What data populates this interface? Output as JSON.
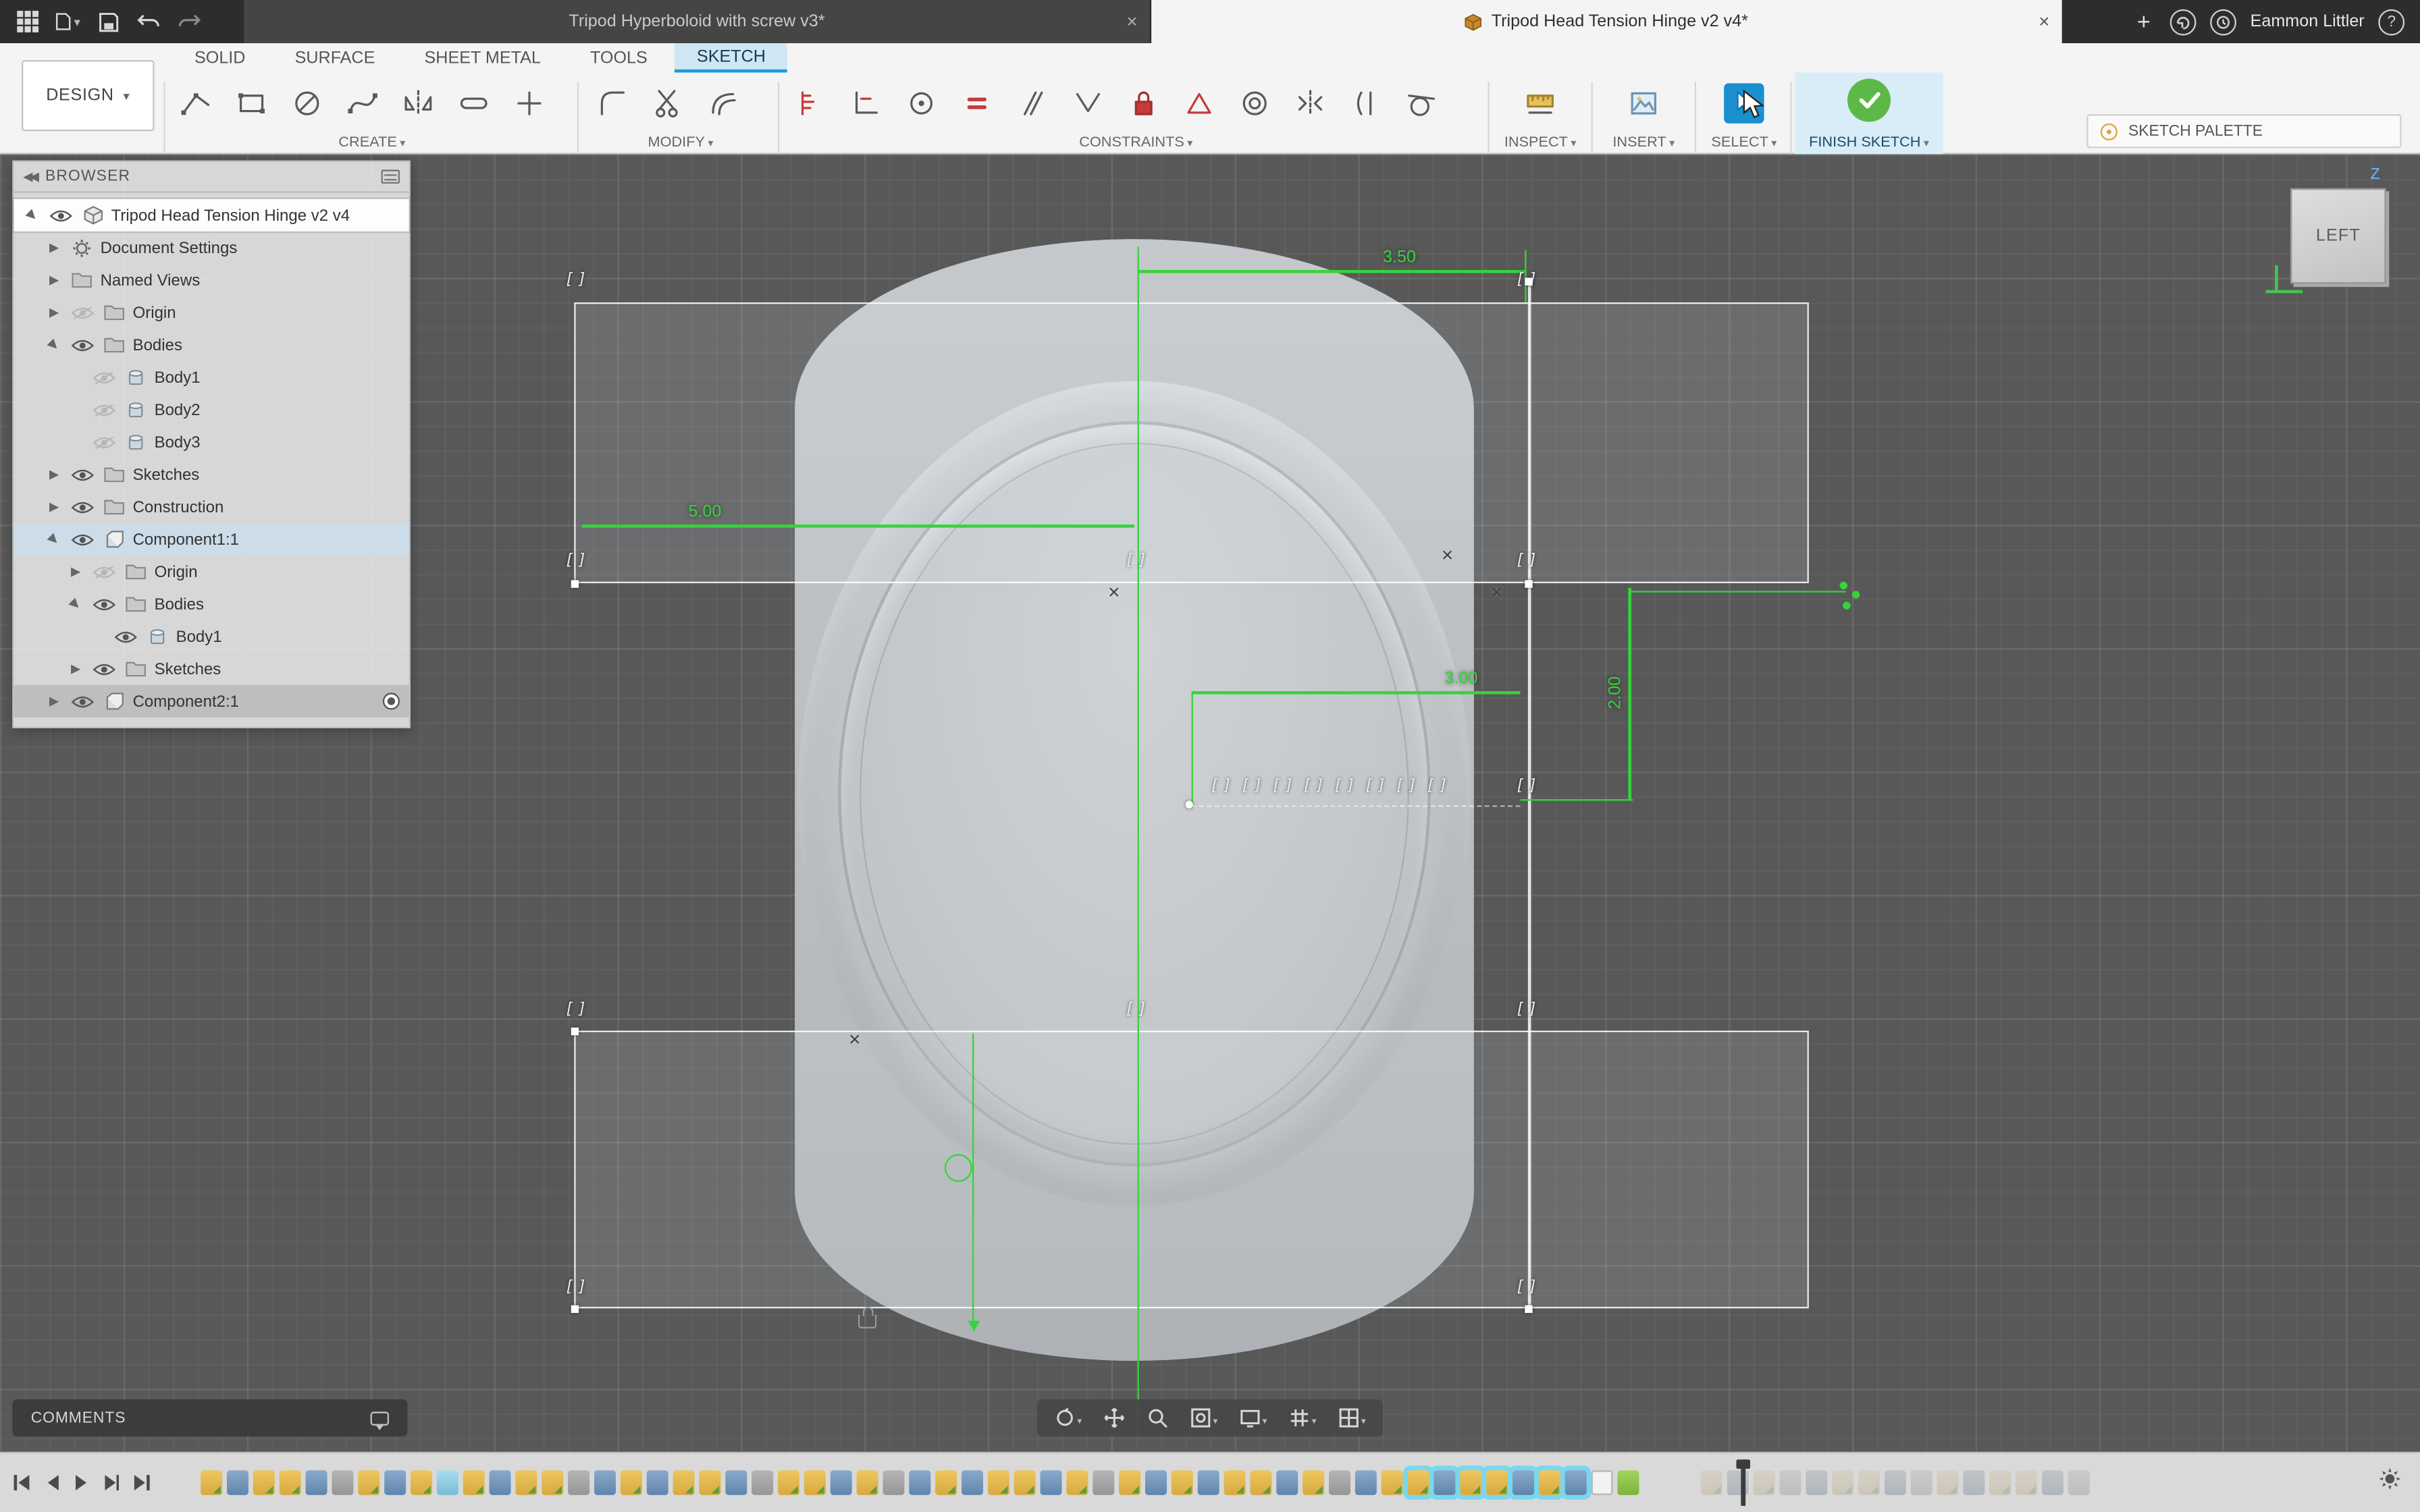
{
  "titlebar": {
    "tabs": [
      {
        "label": "Tripod Hyperboloid with screw v3*",
        "active": false
      },
      {
        "label": "Tripod Head Tension Hinge v2 v4*",
        "active": true
      }
    ],
    "user": "Eammon Littler"
  },
  "ribbon": {
    "design_label": "DESIGN",
    "menu_tabs": [
      {
        "label": "SOLID",
        "active": false
      },
      {
        "label": "SURFACE",
        "active": false
      },
      {
        "label": "SHEET METAL",
        "active": false
      },
      {
        "label": "TOOLS",
        "active": false
      },
      {
        "label": "SKETCH",
        "active": true
      }
    ],
    "groups": [
      {
        "label": "CREATE"
      },
      {
        "label": "MODIFY"
      },
      {
        "label": "CONSTRAINTS"
      },
      {
        "label": "INSPECT"
      },
      {
        "label": "INSERT"
      },
      {
        "label": "SELECT"
      },
      {
        "label": "FINISH SKETCH"
      }
    ],
    "sketch_palette_label": "SKETCH PALETTE"
  },
  "browser": {
    "title": "BROWSER",
    "items": [
      {
        "depth": 0,
        "arrow": "expanded",
        "eye": "on",
        "icon": "document",
        "label": "Tripod Head Tension Hinge v2 v4",
        "highlight": "sel"
      },
      {
        "depth": 1,
        "arrow": "collapsed",
        "eye": null,
        "icon": "gear",
        "label": "Document Settings"
      },
      {
        "depth": 1,
        "arrow": "collapsed",
        "eye": null,
        "icon": "folder",
        "label": "Named Views"
      },
      {
        "depth": 1,
        "arrow": "collapsed",
        "eye": "off",
        "icon": "folder",
        "label": "Origin"
      },
      {
        "depth": 1,
        "arrow": "expanded",
        "eye": "on",
        "icon": "folder",
        "label": "Bodies"
      },
      {
        "depth": 2,
        "arrow": null,
        "eye": "off",
        "icon": "body",
        "label": "Body1"
      },
      {
        "depth": 2,
        "arrow": null,
        "eye": "off",
        "icon": "body",
        "label": "Body2"
      },
      {
        "depth": 2,
        "arrow": null,
        "eye": "off",
        "icon": "body",
        "label": "Body3"
      },
      {
        "depth": 1,
        "arrow": "collapsed",
        "eye": "on",
        "icon": "folder",
        "label": "Sketches"
      },
      {
        "depth": 1,
        "arrow": "collapsed",
        "eye": "on",
        "icon": "folder",
        "label": "Construction"
      },
      {
        "depth": 1,
        "arrow": "expanded",
        "eye": "on",
        "icon": "component",
        "label": "Component1:1",
        "highlight": "comp"
      },
      {
        "depth": 2,
        "arrow": "collapsed",
        "eye": "off",
        "icon": "folder",
        "label": "Origin"
      },
      {
        "depth": 2,
        "arrow": "expanded",
        "eye": "on",
        "icon": "folder",
        "label": "Bodies"
      },
      {
        "depth": 3,
        "arrow": null,
        "eye": "on",
        "icon": "body",
        "label": "Body1"
      },
      {
        "depth": 2,
        "arrow": "collapsed",
        "eye": "on",
        "icon": "folder",
        "label": "Sketches"
      },
      {
        "depth": 1,
        "arrow": "collapsed",
        "eye": "on",
        "icon": "component",
        "label": "Component2:1",
        "highlight": "activecomp",
        "activeDot": true
      }
    ]
  },
  "canvas": {
    "dims": {
      "top": "3.50",
      "left": "5.00",
      "mid": "3.00",
      "right": "2.00"
    },
    "viewcube": {
      "face": "LEFT",
      "axis_z": "Z"
    }
  },
  "comments": {
    "label": "COMMENTS"
  },
  "timeline": {
    "legend": {
      "s": "sketch-feature",
      "e": "extrude-feature",
      "j": "joint-feature",
      "p": "plane-feature",
      "g": "ground-feature",
      "w": "empty-slot",
      "gap": "spacer"
    },
    "features": [
      {
        "k": "s"
      },
      {
        "k": "e"
      },
      {
        "k": "s"
      },
      {
        "k": "s"
      },
      {
        "k": "e"
      },
      {
        "k": "j"
      },
      {
        "k": "s"
      },
      {
        "k": "e"
      },
      {
        "k": "s"
      },
      {
        "k": "p"
      },
      {
        "k": "s"
      },
      {
        "k": "e"
      },
      {
        "k": "s"
      },
      {
        "k": "s"
      },
      {
        "k": "j"
      },
      {
        "k": "e"
      },
      {
        "k": "s"
      },
      {
        "k": "e"
      },
      {
        "k": "s"
      },
      {
        "k": "s"
      },
      {
        "k": "e"
      },
      {
        "k": "j"
      },
      {
        "k": "s"
      },
      {
        "k": "s"
      },
      {
        "k": "e"
      },
      {
        "k": "s"
      },
      {
        "k": "j"
      },
      {
        "k": "e"
      },
      {
        "k": "s"
      },
      {
        "k": "e"
      },
      {
        "k": "s"
      },
      {
        "k": "s"
      },
      {
        "k": "e"
      },
      {
        "k": "s"
      },
      {
        "k": "j"
      },
      {
        "k": "s"
      },
      {
        "k": "e"
      },
      {
        "k": "s"
      },
      {
        "k": "e"
      },
      {
        "k": "s"
      },
      {
        "k": "s"
      },
      {
        "k": "e"
      },
      {
        "k": "s"
      },
      {
        "k": "j"
      },
      {
        "k": "e"
      },
      {
        "k": "s"
      },
      {
        "k": "s",
        "st": "h"
      },
      {
        "k": "e",
        "st": "h"
      },
      {
        "k": "s",
        "st": "h"
      },
      {
        "k": "s",
        "st": "h"
      },
      {
        "k": "e",
        "st": "h"
      },
      {
        "k": "s",
        "st": "h"
      },
      {
        "k": "e",
        "st": "h"
      },
      {
        "k": "w"
      },
      {
        "k": "g"
      },
      {
        "k": "gap"
      },
      {
        "k": "s",
        "st": "f"
      },
      {
        "k": "e",
        "st": "f"
      },
      {
        "k": "s",
        "st": "f"
      },
      {
        "k": "j",
        "st": "f"
      },
      {
        "k": "e",
        "st": "f"
      },
      {
        "k": "s",
        "st": "f"
      },
      {
        "k": "s",
        "st": "f"
      },
      {
        "k": "e",
        "st": "f"
      },
      {
        "k": "j",
        "st": "f"
      },
      {
        "k": "s",
        "st": "f"
      },
      {
        "k": "e",
        "st": "f"
      },
      {
        "k": "s",
        "st": "f"
      },
      {
        "k": "s",
        "st": "f"
      },
      {
        "k": "e",
        "st": "f"
      },
      {
        "k": "j",
        "st": "f"
      }
    ]
  }
}
